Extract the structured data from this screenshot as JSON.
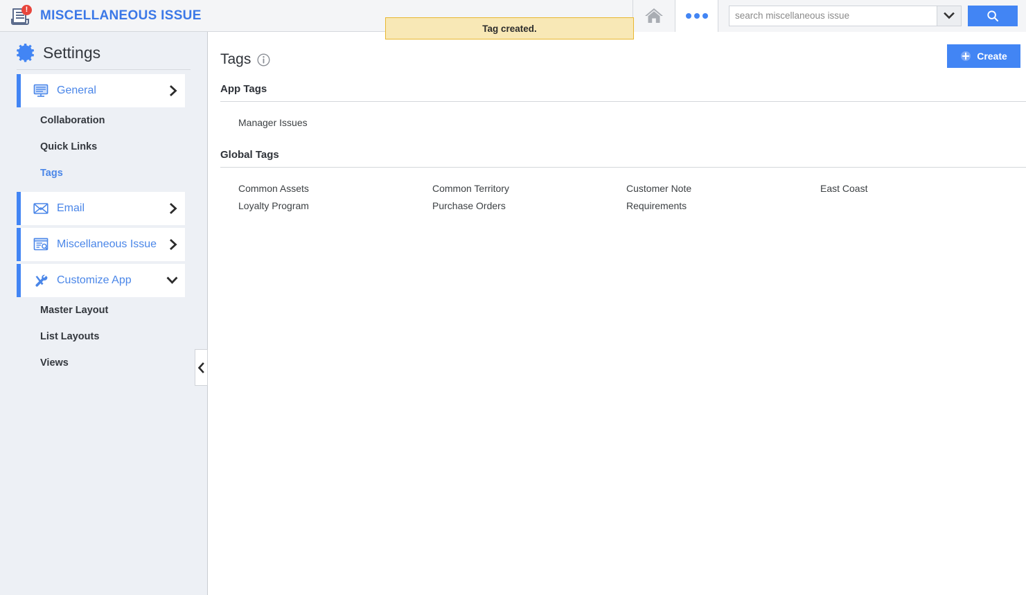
{
  "app": {
    "title": "MISCELLANEOUS ISSUE",
    "logo_icon": "document-issue-icon",
    "badge_text": "!",
    "badge_color": "#e8453c",
    "brand_color": "#3b78e7"
  },
  "notification": {
    "message": "Tag created.",
    "background": "#f8e8b6",
    "border_color": "#e8b730"
  },
  "topbar": {
    "home_icon": "home-icon",
    "more_icon": "more-dots-icon",
    "search": {
      "placeholder": "search miscellaneous issue",
      "value": "",
      "dropdown_icon": "chevron-down-icon",
      "button_icon": "search-icon",
      "button_color": "#4285f4"
    }
  },
  "sidebar": {
    "heading": "Settings",
    "heading_icon": "gear-icon",
    "collapse_icon": "chevron-left-icon",
    "groups": [
      {
        "label": "General",
        "icon": "monitor-icon",
        "chevron": "chevron-right-icon",
        "active": true,
        "children": [
          {
            "label": "Collaboration",
            "active": false
          },
          {
            "label": "Quick Links",
            "active": false
          },
          {
            "label": "Tags",
            "active": true
          }
        ]
      },
      {
        "label": "Email",
        "icon": "envelope-icon",
        "chevron": "chevron-right-icon",
        "active": false,
        "children": []
      },
      {
        "label": "Miscellaneous Issue",
        "icon": "form-search-icon",
        "chevron": "chevron-right-icon",
        "active": false,
        "children": []
      },
      {
        "label": "Customize App",
        "icon": "tools-icon",
        "chevron": "chevron-down-icon",
        "active": false,
        "children": [
          {
            "label": "Master Layout",
            "active": false
          },
          {
            "label": "List Layouts",
            "active": false
          },
          {
            "label": "Views",
            "active": false
          }
        ]
      }
    ]
  },
  "main": {
    "page_title": "Tags",
    "page_title_info_icon": "info-icon",
    "create_button": {
      "label": "Create",
      "icon": "plus-circle-icon",
      "color": "#4285f4"
    },
    "sections": [
      {
        "title": "App Tags",
        "tags": [
          "Manager Issues"
        ]
      },
      {
        "title": "Global Tags",
        "tags": [
          "Common Assets",
          "Common Territory",
          "Customer Note",
          "East Coast",
          "Loyalty Program",
          "Purchase Orders",
          "Requirements"
        ]
      }
    ]
  }
}
